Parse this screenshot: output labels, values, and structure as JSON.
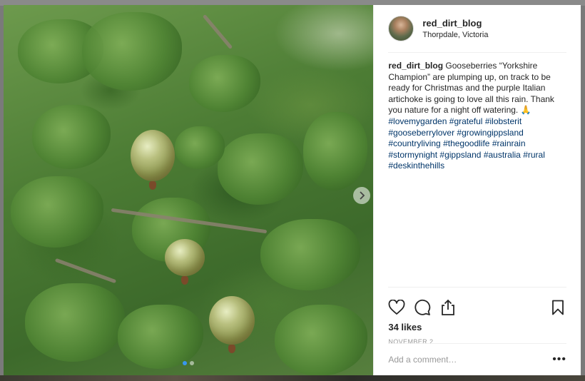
{
  "post": {
    "username": "red_dirt_blog",
    "location": "Thorpdale, Victoria",
    "caption_text": "Gooseberries “Yorkshire Champion” are plumping up, on track to be ready for Christmas and the purple Italian artichoke is going to love all this rain. Thank you nature for a night off watering. 🙏",
    "hashtags": [
      "#lovemygarden",
      "#grateful",
      "#ilobsterit",
      "#gooseberrylover",
      "#growingippsland",
      "#countryliving",
      "#thegoodlife",
      "#rainrain",
      "#stormynight",
      "#gippsland",
      "#australia",
      "#rural",
      "#deskinthehills"
    ],
    "likes": "34 likes",
    "date": "NOVEMBER 2"
  },
  "comment": {
    "placeholder": "Add a comment…"
  },
  "carousel": {
    "slide_count": 2,
    "active_slide": 1
  },
  "icons": {
    "like": "heart-icon",
    "comment": "comment-icon",
    "share": "share-icon",
    "save": "bookmark-icon",
    "next": "chevron-right-icon",
    "more": "more-options-icon"
  },
  "colors": {
    "hashtag": "#003569",
    "active_dot": "#3897f0"
  }
}
